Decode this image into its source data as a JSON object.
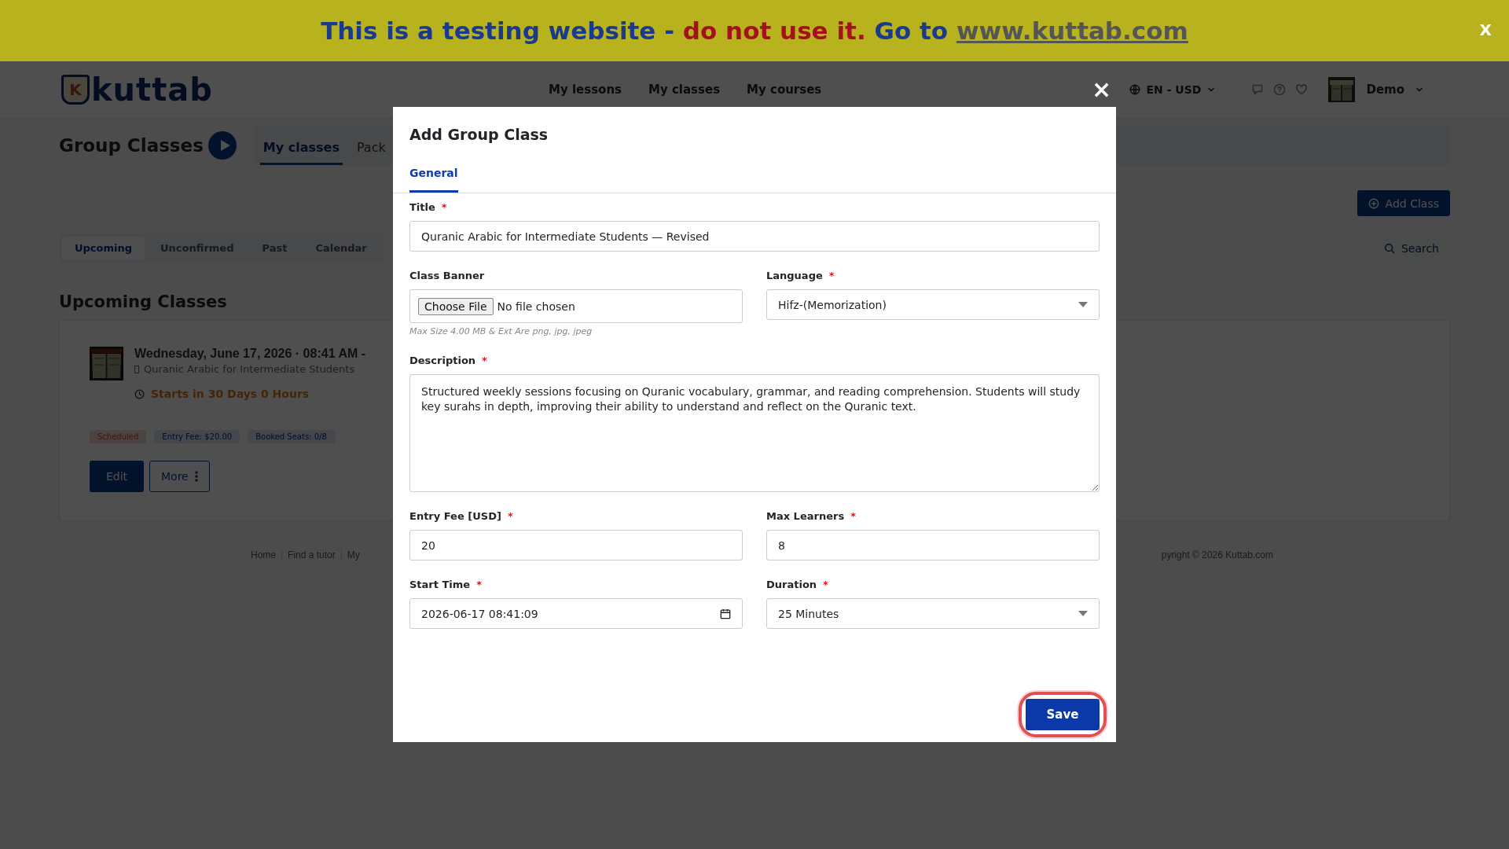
{
  "banner": {
    "segments": [
      {
        "kind": "plain",
        "text": "This is a testing website - "
      },
      {
        "kind": "warning",
        "text": "do not use it."
      },
      {
        "kind": "plain",
        "text": " Go to "
      },
      {
        "kind": "link",
        "text": "www.kuttab.com"
      }
    ],
    "close": "X"
  },
  "header": {
    "logo": {
      "mark": "K",
      "text": "kuttab"
    },
    "nav": [
      {
        "label": "My lessons"
      },
      {
        "label": "My classes"
      },
      {
        "label": "My courses"
      }
    ],
    "locale": "EN - USD",
    "user": "Demo"
  },
  "page": {
    "title": "Group Classes",
    "tabs": [
      {
        "label": "My classes",
        "selected": true
      },
      {
        "label": "Pack",
        "selected": false
      }
    ],
    "add_button": "Add Class",
    "filters": [
      {
        "label": "Upcoming",
        "selected": true
      },
      {
        "label": "Unconfirmed",
        "selected": false
      },
      {
        "label": "Past",
        "selected": false
      },
      {
        "label": "Calendar",
        "selected": false
      }
    ],
    "search": "Search",
    "section_title": "Upcoming Classes",
    "card": {
      "date": "Wednesday, June 17, 2026 · 08:41 AM -",
      "subtitle": "Quranic Arabic for Intermediate Students",
      "countdown": "Starts in 30 Days 0 Hours",
      "badges": [
        {
          "kind": "status",
          "text": "Scheduled"
        },
        {
          "kind": "info",
          "text": "Entry Fee: $20.00"
        },
        {
          "kind": "info",
          "text": "Booked Seats: 0/8"
        }
      ],
      "buttons": [
        {
          "kind": "primary",
          "label": "Edit"
        },
        {
          "kind": "menu",
          "label": "More"
        }
      ]
    }
  },
  "footer": {
    "links": [
      {
        "label": "Home"
      },
      {
        "label": "Find a tutor"
      },
      {
        "label": "My"
      }
    ],
    "copyright": "pyright © 2026 Kuttab.com"
  },
  "modal": {
    "title": "Add Group Class",
    "close": "×",
    "tabs": [
      {
        "label": "General",
        "selected": true
      }
    ],
    "rows": [
      [
        {
          "kind": "text",
          "label": "Title",
          "required_mark": "*",
          "value": "Quranic Arabic for Intermediate Students — Revised"
        }
      ],
      [
        {
          "kind": "file",
          "label": "Class Banner",
          "button": "Choose File",
          "value": "No file chosen",
          "help": "Max Size 4.00 MB & Ext Are png, jpg, jpeg"
        },
        {
          "kind": "select",
          "label": "Language",
          "required_mark": "*",
          "value": "Hifz-(Memorization)"
        }
      ],
      [
        {
          "kind": "textarea",
          "label": "Description",
          "required_mark": "*",
          "value": "Structured weekly sessions focusing on Quranic vocabulary, grammar, and reading comprehension. Students will study key surahs in depth, improving their ability to understand and reflect on the Quranic text."
        }
      ],
      [
        {
          "kind": "text",
          "label": "Entry Fee [USD]",
          "required_mark": "*",
          "value": "20"
        },
        {
          "kind": "text",
          "label": "Max Learners",
          "required_mark": "*",
          "value": "8"
        }
      ],
      [
        {
          "kind": "datetime",
          "label": "Start Time",
          "required_mark": "*",
          "value": "2026-06-17 08:41:09"
        },
        {
          "kind": "select",
          "label": "Duration",
          "required_mark": "*",
          "value": "25 Minutes"
        }
      ]
    ],
    "save": {
      "label": "Save",
      "focused": true
    }
  }
}
